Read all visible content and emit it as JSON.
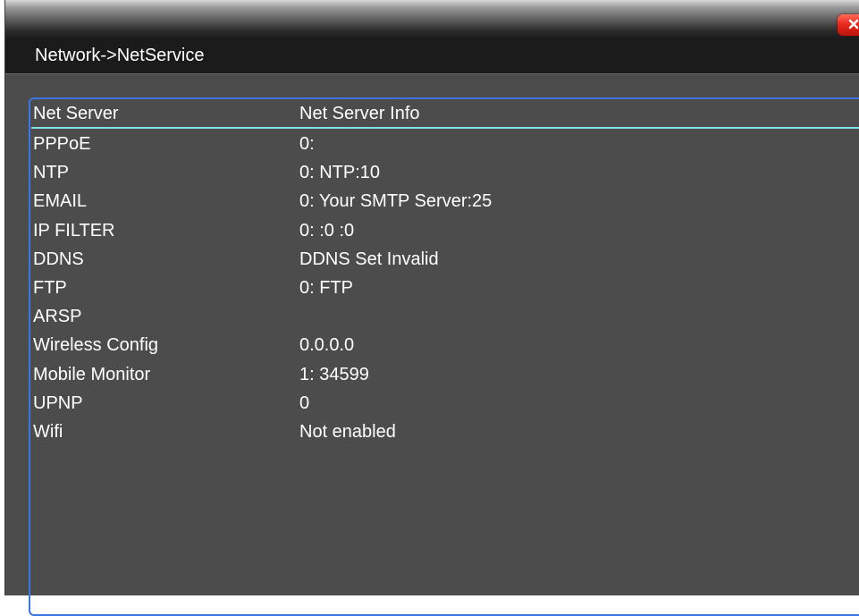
{
  "title": "Network->NetService",
  "columns": {
    "server": "Net Server",
    "info": "Net Server Info"
  },
  "rows": [
    {
      "name": "PPPoE",
      "info": "0:"
    },
    {
      "name": "NTP",
      "info": "0: NTP:10"
    },
    {
      "name": "EMAIL",
      "info": "0: Your SMTP Server:25"
    },
    {
      "name": "IP FILTER",
      "info": "0: :0 :0"
    },
    {
      "name": "DDNS",
      "info": "DDNS Set Invalid"
    },
    {
      "name": "FTP",
      "info": "0: FTP"
    },
    {
      "name": "ARSP",
      "info": ""
    },
    {
      "name": "Wireless Config",
      "info": "0.0.0.0"
    },
    {
      "name": "Mobile Monitor",
      "info": "1: 34599"
    },
    {
      "name": "UPNP",
      "info": "0"
    },
    {
      "name": "Wifi",
      "info": "Not enabled"
    }
  ],
  "icons": {
    "close": "close-icon"
  },
  "colors": {
    "background": "#4c4c4c",
    "header_bar": "#1b1b1b",
    "panel_border": "#3d74e6",
    "header_line": "#7fe0e6",
    "close_button": "#e8251a",
    "text": "#ffffff"
  }
}
